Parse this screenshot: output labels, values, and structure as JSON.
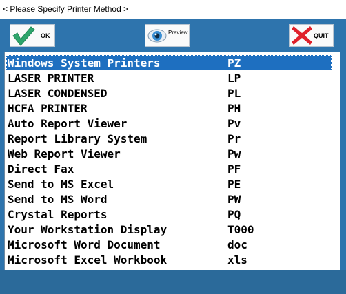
{
  "window": {
    "title": "< Please Specify Printer Method >"
  },
  "toolbar": {
    "ok_label": "OK",
    "preview_label": "Preview",
    "quit_label": "QUIT"
  },
  "printers": [
    {
      "name": "Windows System Printers",
      "code": "PZ",
      "selected": true
    },
    {
      "name": "LASER PRINTER",
      "code": "LP"
    },
    {
      "name": "LASER CONDENSED",
      "code": "PL"
    },
    {
      "name": "HCFA PRINTER",
      "code": "PH"
    },
    {
      "name": "Auto Report Viewer",
      "code": "Pv"
    },
    {
      "name": "Report Library System",
      "code": "Pr"
    },
    {
      "name": "Web Report Viewer",
      "code": "Pw"
    },
    {
      "name": "Direct Fax",
      "code": "PF"
    },
    {
      "name": "Send to MS Excel",
      "code": "PE"
    },
    {
      "name": "Send to MS Word",
      "code": "PW"
    },
    {
      "name": "Crystal Reports",
      "code": "PQ"
    },
    {
      "name": "Your Workstation Display",
      "code": "T000"
    },
    {
      "name": "Microsoft Word Document",
      "code": "doc"
    },
    {
      "name": "Microsoft Excel Workbook",
      "code": "xls"
    }
  ],
  "colors": {
    "dialog_background": "#2e74ad",
    "selection": "#1e6fc0",
    "ok_check": "#2fa56c",
    "quit_x": "#e0202a"
  }
}
